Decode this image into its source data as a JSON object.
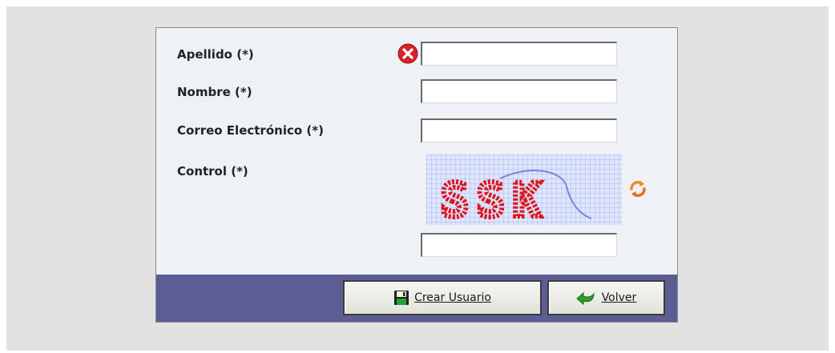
{
  "form": {
    "fields": [
      {
        "label": "Apellido (*)",
        "value": "",
        "has_error": true
      },
      {
        "label": "Nombre (*)",
        "value": ""
      },
      {
        "label": "Correo Electrónico (*)",
        "value": ""
      },
      {
        "label": "Control (*)",
        "value": ""
      }
    ],
    "captcha": {
      "text": "SSK",
      "text_color": "#e0141c",
      "grid_color": "#a9b8e8"
    },
    "error_icon": "error-circle-x-icon",
    "refresh_icon": "refresh-arrows-icon"
  },
  "buttons": {
    "create_label": "Crear Usuario",
    "create_icon": "floppy-disk-icon",
    "back_label": "Volver",
    "back_icon": "green-back-arrow-icon"
  },
  "colors": {
    "page_background": "#e2e2e2",
    "panel_background": "#eef1f5",
    "button_bar": "#5c5d95",
    "error_red": "#d9222a"
  }
}
